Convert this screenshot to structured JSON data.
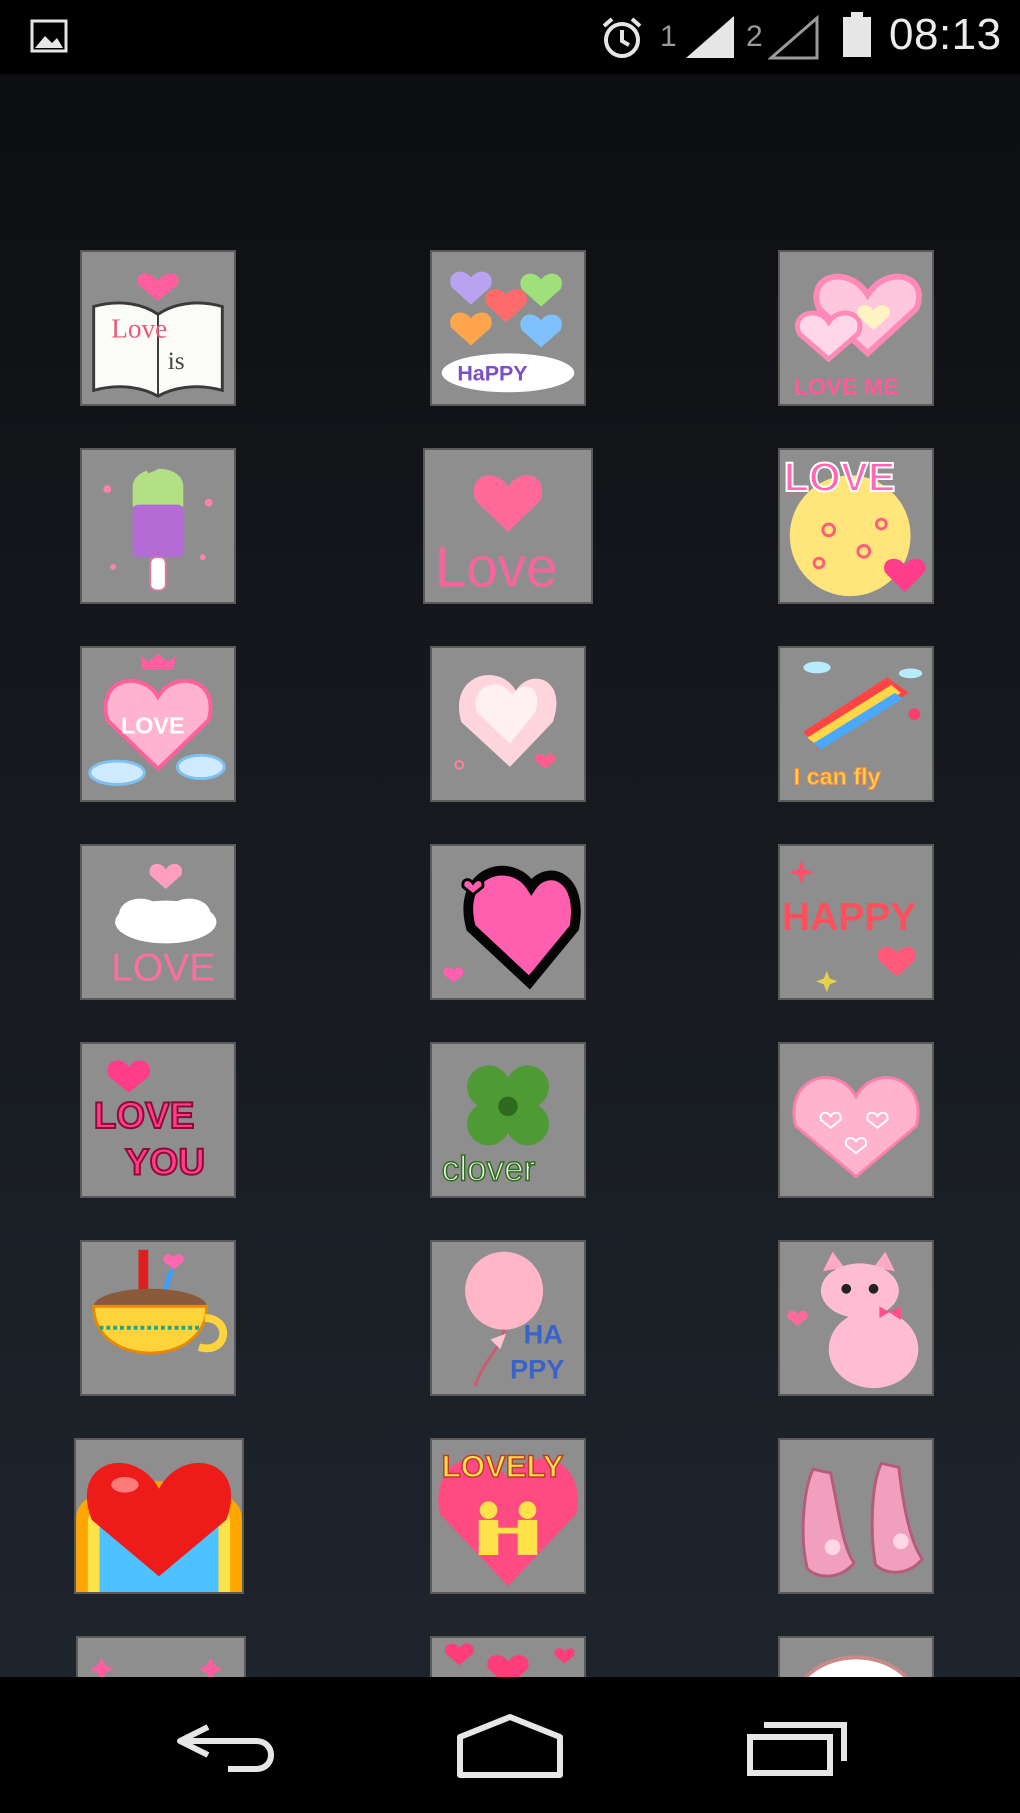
{
  "status_bar": {
    "time": "08:13",
    "sim1_label": "1",
    "sim2_label": "2",
    "icons": [
      "gallery-notification-icon",
      "alarm-clock-icon",
      "signal-strength-icon",
      "signal-empty-icon",
      "battery-icon"
    ]
  },
  "stickers": {
    "row1": {
      "s1": "Love",
      "s1b": "is",
      "s2": "HaPPY",
      "s3": "LOVE ME"
    },
    "row2": {
      "s2": "Love",
      "s3": "LOVE"
    },
    "row3": {
      "s1": "LOVE",
      "s3": "I can fly"
    },
    "row4": {
      "s1": "LOVE",
      "s3": "HAPPY"
    },
    "row5": {
      "s1": "LOVE",
      "s1b": "YOU",
      "s2": "clover"
    },
    "row6": {
      "s2a": "HA",
      "s2b": "PPY"
    },
    "row7": {
      "s2": "LOVELY"
    }
  },
  "nav_bar": {
    "icons": [
      "back-icon",
      "home-icon",
      "recent-apps-icon"
    ]
  },
  "colors": {
    "tile_background": "#8e8e8e",
    "pink": "#f5679c",
    "status_bar": "#000000"
  }
}
